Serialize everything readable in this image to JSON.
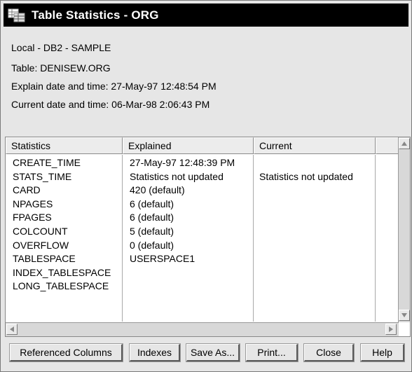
{
  "window": {
    "title": "Table Statistics - ORG",
    "icon": "table-statistics-icon"
  },
  "info": {
    "location": "Local - DB2 - SAMPLE",
    "table": "Table: DENISEW.ORG",
    "explain_datetime": "Explain date and time: 27-May-97 12:48:54 PM",
    "current_datetime": "Current date and time: 06-Mar-98 2:06:43 PM"
  },
  "table": {
    "headers": [
      "Statistics",
      "Explained",
      "Current"
    ],
    "statistics": [
      "CREATE_TIME",
      "STATS_TIME",
      "CARD",
      "NPAGES",
      "FPAGES",
      "COLCOUNT",
      "OVERFLOW",
      "TABLESPACE",
      "INDEX_TABLESPACE",
      "LONG_TABLESPACE"
    ],
    "explained": [
      "27-May-97 12:48:39 PM",
      "Statistics not updated",
      "420 (default)",
      "6 (default)",
      "6 (default)",
      "5 (default)",
      "0 (default)",
      "USERSPACE1",
      "",
      ""
    ],
    "current": [
      "",
      "Statistics not updated",
      "",
      "",
      "",
      "",
      "",
      "",
      "",
      ""
    ]
  },
  "buttons": {
    "referenced_columns": "Referenced Columns",
    "indexes": "Indexes",
    "save_as": "Save As...",
    "print": "Print...",
    "close": "Close",
    "help": "Help"
  }
}
